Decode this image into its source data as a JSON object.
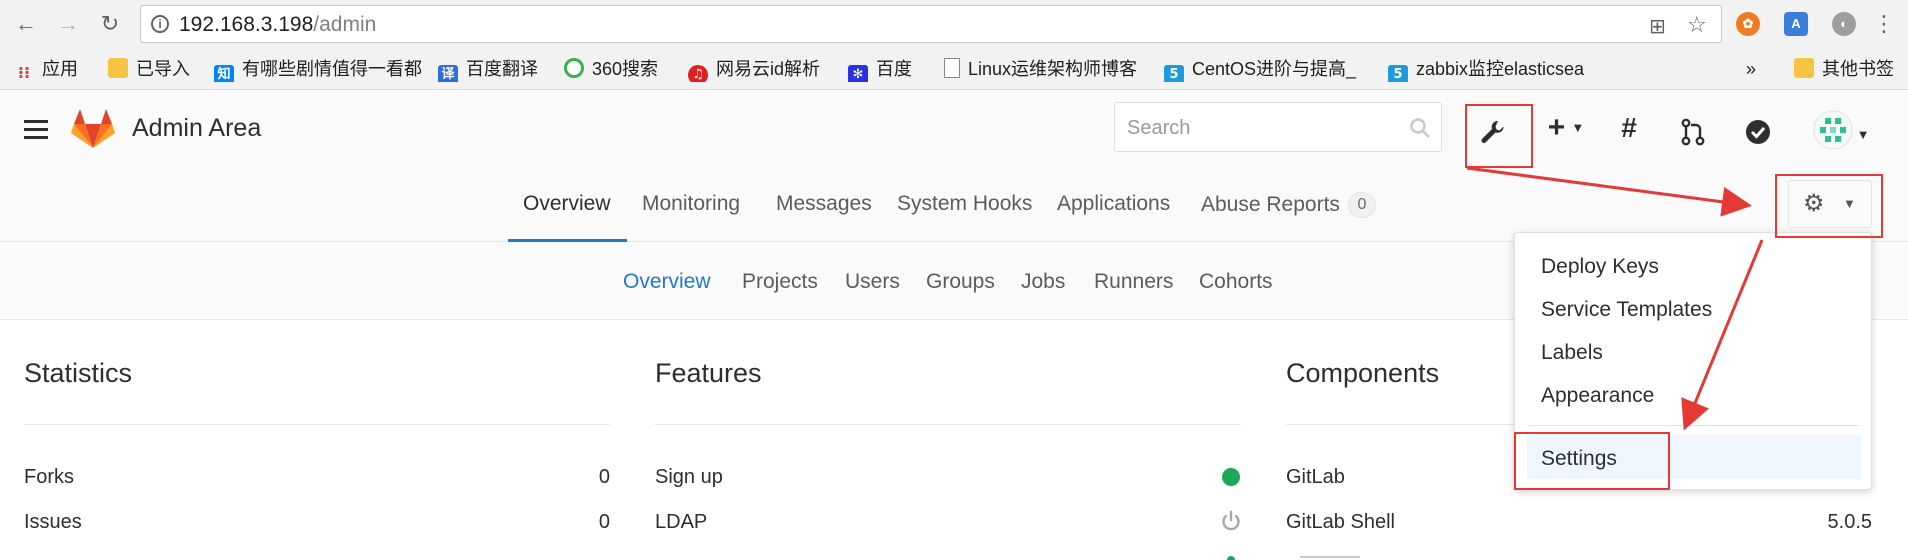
{
  "browser": {
    "url_host": "192.168.3.198",
    "url_path": "/admin",
    "bookmarks": [
      {
        "label": "应用"
      },
      {
        "label": "已导入"
      },
      {
        "label": "有哪些剧情值得一看都"
      },
      {
        "label": "百度翻译"
      },
      {
        "label": "360搜索"
      },
      {
        "label": "网易云id解析"
      },
      {
        "label": "百度"
      },
      {
        "label": "Linux运维架构师博客"
      },
      {
        "label": "CentOS进阶与提高_"
      },
      {
        "label": "zabbix监控elasticsea"
      }
    ],
    "overflow": "»",
    "other_bookmarks": "其他书签"
  },
  "header": {
    "title": "Admin Area",
    "search_placeholder": "Search"
  },
  "top_nav": {
    "tabs": [
      "Overview",
      "Monitoring",
      "Messages",
      "System Hooks",
      "Applications",
      "Abuse Reports"
    ],
    "abuse_count": "0"
  },
  "sub_nav": {
    "items": [
      "Overview",
      "Projects",
      "Users",
      "Groups",
      "Jobs",
      "Runners",
      "Cohorts"
    ]
  },
  "dropdown": {
    "items": [
      "Deploy Keys",
      "Service Templates",
      "Labels",
      "Appearance"
    ],
    "settings": "Settings"
  },
  "statistics": {
    "title": "Statistics",
    "rows": [
      {
        "label": "Forks",
        "value": "0"
      },
      {
        "label": "Issues",
        "value": "0"
      }
    ]
  },
  "features": {
    "title": "Features",
    "rows": [
      {
        "label": "Sign up"
      },
      {
        "label": "LDAP"
      }
    ]
  },
  "components": {
    "title": "Components",
    "rows": [
      {
        "label": "GitLab",
        "value": ""
      },
      {
        "label": "GitLab Shell",
        "value": "5.0.5"
      }
    ]
  },
  "colors": {
    "accent": "#1f78d1",
    "annotation": "#e53935",
    "status_on": "#1aaa55",
    "status_off": "#a8a8a8"
  }
}
